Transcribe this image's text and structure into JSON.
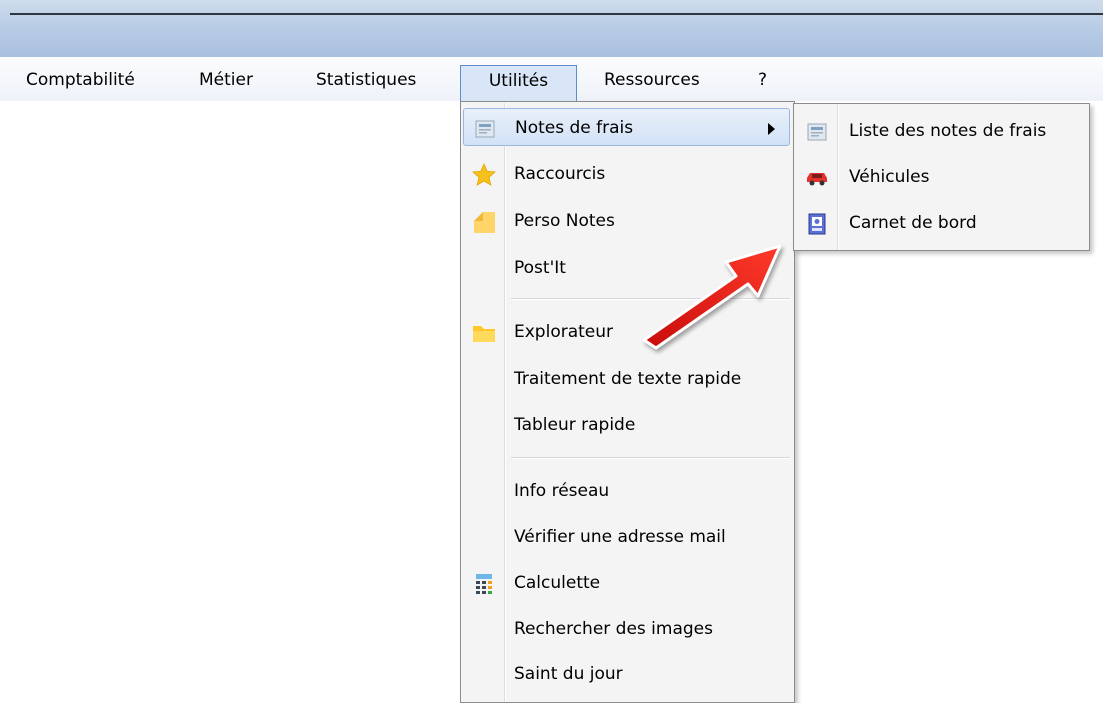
{
  "menubar": {
    "items": [
      "Comptabilité",
      "Métier",
      "Statistiques",
      "Utilités",
      "Ressources",
      "?"
    ]
  },
  "utilites_menu": {
    "items": {
      "notes_de_frais": "Notes de frais",
      "raccourcis": "Raccourcis",
      "perso_notes": "Perso Notes",
      "post_it": "Post'It",
      "explorateur": "Explorateur",
      "traitement": "Traitement de texte rapide",
      "tableur": "Tableur rapide",
      "info_reseau": "Info réseau",
      "verifier_mail": "Vérifier une adresse mail",
      "calculette": "Calculette",
      "rechercher_images": "Rechercher des images",
      "saint_du_jour": "Saint du jour"
    },
    "icons": {
      "notes_de_frais": "notes-de-frais-icon",
      "raccourcis": "star-icon",
      "perso_notes": "sticky-note-icon",
      "explorateur": "folder-icon",
      "calculette": "calculator-icon"
    }
  },
  "submenu": {
    "items": {
      "liste": "Liste des notes de frais",
      "vehicules": "Véhicules",
      "carnet": "Carnet de bord"
    },
    "icons": {
      "liste": "list-icon",
      "vehicules": "car-icon",
      "carnet": "logbook-icon"
    }
  },
  "colors": {
    "highlight": "#d2e2f6",
    "annotation_arrow": "#e01515"
  }
}
